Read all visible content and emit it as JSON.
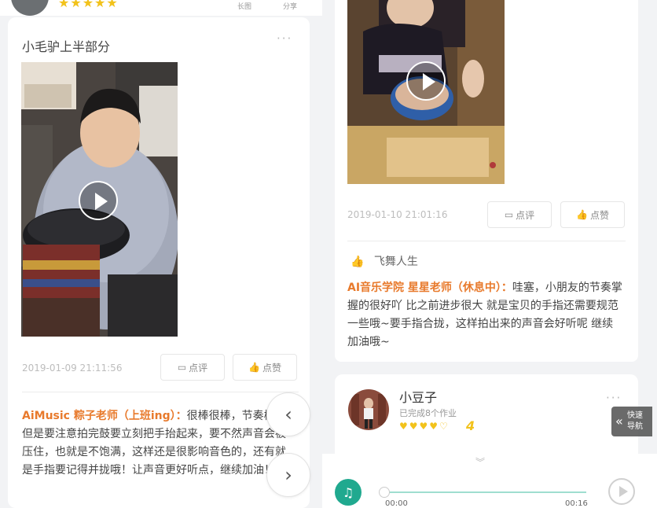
{
  "left_top": {
    "stars": "★★★★★",
    "long_image_label": "长图",
    "share_label": "分享"
  },
  "left_card": {
    "title": "小毛驴上半部分",
    "more_icon": "···",
    "timestamp": "2019-01-09 21:11:56",
    "comment_button": "点评",
    "like_button": "点赞",
    "comment_author": "AiMusic 粽子老师（上班ing）：",
    "comment_text": "很棒很棒，节奏棒，但是要注意拍完鼓要立刻把手抬起来，要不然声音会被压住，也就是不饱满，这样还是很影响音色的，还有就是手指要记得并拢哦！让声音更好听点，继续加油！"
  },
  "nav": {
    "prev_icon": "‹",
    "next_icon": "›"
  },
  "right_card": {
    "timestamp": "2019-01-10 21:01:16",
    "comment_button": "点评",
    "like_button": "点赞",
    "liker_name": "飞舞人生",
    "comment_author": "AI音乐学院 星星老师（休息中）：",
    "comment_text": "哇塞，小朋友的节奏掌握的很好吖 比之前进步很大 就是宝贝的手指还需要规范一些哦~要手指合拢，这样拍出来的声音会好听呢 继续加油哦~"
  },
  "user_card": {
    "name": "小豆子",
    "subtitle": "已完成8个作业",
    "stars": "♥♥♥♥♡",
    "score": "4",
    "more_icon": "···"
  },
  "quick_nav": {
    "icon": "«",
    "label_line1": "快速",
    "label_line2": "导航"
  },
  "player": {
    "collapse_icon": "︾",
    "music_icon": "♫",
    "current_time": "00:00",
    "total_time": "00:16",
    "progress": 0
  }
}
